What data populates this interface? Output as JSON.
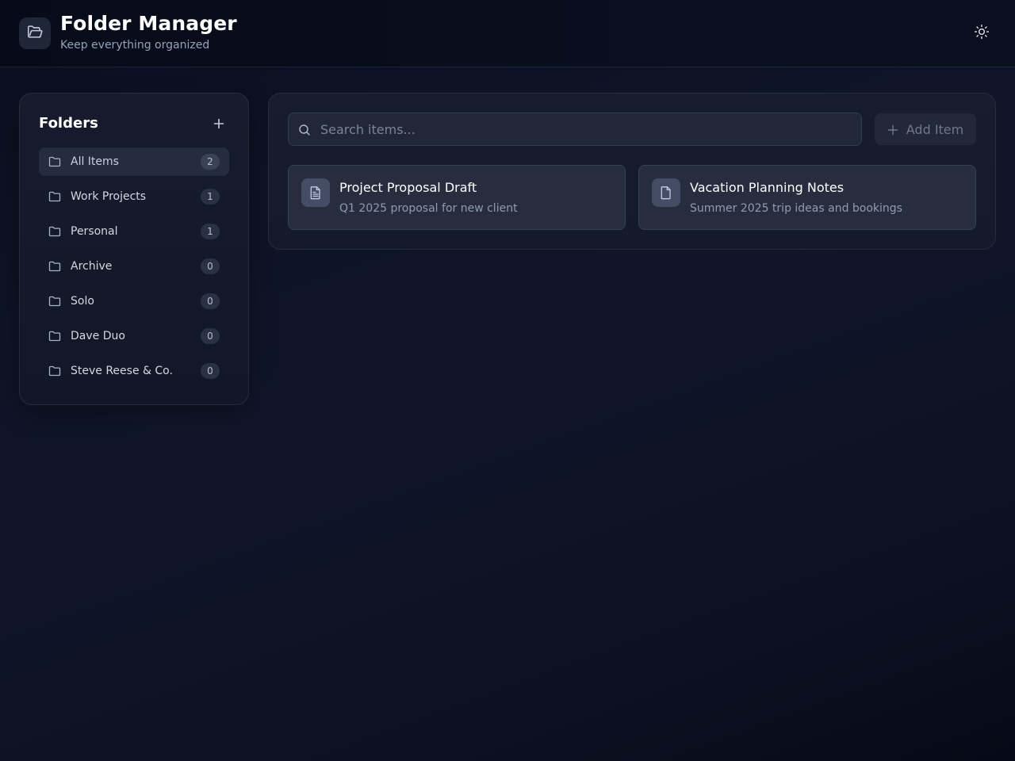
{
  "header": {
    "title": "Folder Manager",
    "subtitle": "Keep everything organized",
    "logo_icon": "folder-open-icon",
    "theme_icon": "sun-icon"
  },
  "sidebar": {
    "title": "Folders",
    "add_icon": "plus-icon",
    "folders": [
      {
        "label": "All Items",
        "count": "2",
        "active": true
      },
      {
        "label": "Work Projects",
        "count": "1",
        "active": false
      },
      {
        "label": "Personal",
        "count": "1",
        "active": false
      },
      {
        "label": "Archive",
        "count": "0",
        "active": false
      },
      {
        "label": "Solo",
        "count": "0",
        "active": false
      },
      {
        "label": "Dave Duo",
        "count": "0",
        "active": false
      },
      {
        "label": "Steve Reese & Co.",
        "count": "0",
        "active": false
      }
    ]
  },
  "main": {
    "search": {
      "placeholder": "Search items...",
      "value": ""
    },
    "add_item_label": "Add Item",
    "items": [
      {
        "title": "Project Proposal Draft",
        "description": "Q1 2025 proposal for new client",
        "icon": "file-text-icon"
      },
      {
        "title": "Vacation Planning Notes",
        "description": "Summer 2025 trip ideas and bookings",
        "icon": "file-icon"
      }
    ]
  },
  "colors": {
    "background": "#0b1020",
    "panel": "#161b2d",
    "card": "#272d3f",
    "active_folder": "#252c40",
    "muted_text": "#94a3b8"
  }
}
